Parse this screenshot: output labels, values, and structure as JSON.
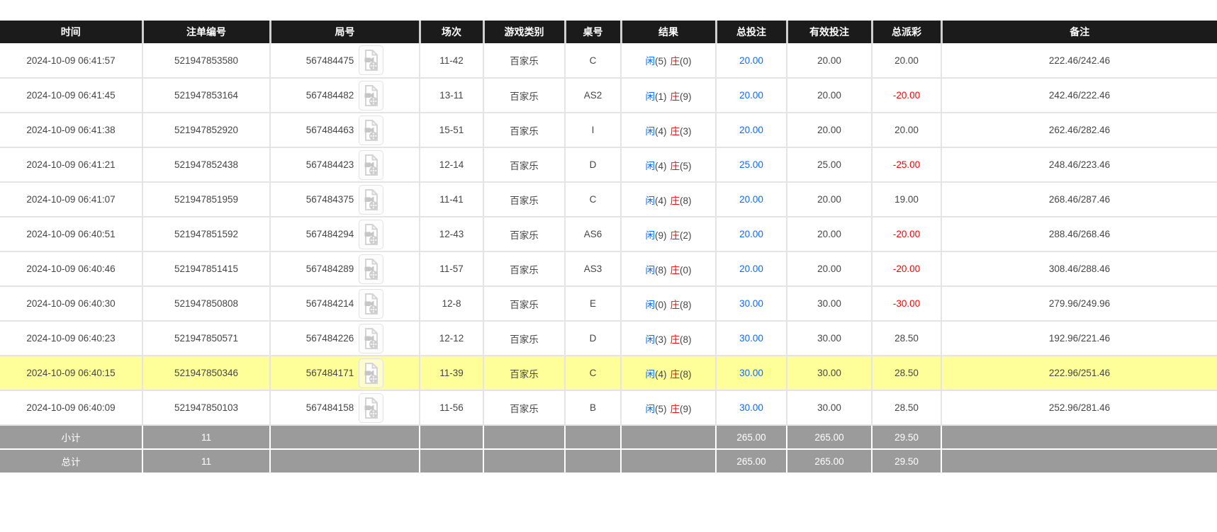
{
  "columns": [
    {
      "label": "时间"
    },
    {
      "label": "注单编号"
    },
    {
      "label": "局号"
    },
    {
      "label": "场次"
    },
    {
      "label": "游戏类别"
    },
    {
      "label": "桌号"
    },
    {
      "label": "结果"
    },
    {
      "label": "总投注"
    },
    {
      "label": "有效投注"
    },
    {
      "label": "总派彩"
    },
    {
      "label": "备注"
    }
  ],
  "labels": {
    "xian": "闲",
    "zhuang": "庄",
    "video_icon": "video-replay-icon"
  },
  "colors": {
    "header_bg": "#1b1b1b",
    "highlight_row": "#ffff99",
    "footer_bg": "#9b9b9b",
    "bet_blue": "#0b6aff",
    "loss_red": "#ff0000"
  },
  "rows": [
    {
      "time": "2024-10-09 06:41:57",
      "bet_no": "521947853580",
      "round_no": "567484475",
      "session": "11-42",
      "game_type": "百家乐",
      "table_no": "C",
      "result": {
        "xian": "(5)",
        "zhuang": "(0)"
      },
      "total_bet": "20.00",
      "valid_bet": "20.00",
      "payout": "20.00",
      "remark": "222.46/242.46",
      "highlighted": false
    },
    {
      "time": "2024-10-09 06:41:45",
      "bet_no": "521947853164",
      "round_no": "567484482",
      "session": "13-11",
      "game_type": "百家乐",
      "table_no": "AS2",
      "result": {
        "xian": "(1)",
        "zhuang": "(9)"
      },
      "total_bet": "20.00",
      "valid_bet": "20.00",
      "payout": "-20.00",
      "remark": "242.46/222.46",
      "highlighted": false
    },
    {
      "time": "2024-10-09 06:41:38",
      "bet_no": "521947852920",
      "round_no": "567484463",
      "session": "15-51",
      "game_type": "百家乐",
      "table_no": "I",
      "result": {
        "xian": "(4)",
        "zhuang": "(3)"
      },
      "total_bet": "20.00",
      "valid_bet": "20.00",
      "payout": "20.00",
      "remark": "262.46/282.46",
      "highlighted": false
    },
    {
      "time": "2024-10-09 06:41:21",
      "bet_no": "521947852438",
      "round_no": "567484423",
      "session": "12-14",
      "game_type": "百家乐",
      "table_no": "D",
      "result": {
        "xian": "(4)",
        "zhuang": "(5)"
      },
      "total_bet": "25.00",
      "valid_bet": "25.00",
      "payout": "-25.00",
      "remark": "248.46/223.46",
      "highlighted": false
    },
    {
      "time": "2024-10-09 06:41:07",
      "bet_no": "521947851959",
      "round_no": "567484375",
      "session": "11-41",
      "game_type": "百家乐",
      "table_no": "C",
      "result": {
        "xian": "(4)",
        "zhuang": "(8)"
      },
      "total_bet": "20.00",
      "valid_bet": "20.00",
      "payout": "19.00",
      "remark": "268.46/287.46",
      "highlighted": false
    },
    {
      "time": "2024-10-09 06:40:51",
      "bet_no": "521947851592",
      "round_no": "567484294",
      "session": "12-43",
      "game_type": "百家乐",
      "table_no": "AS6",
      "result": {
        "xian": "(9)",
        "zhuang": "(2)"
      },
      "total_bet": "20.00",
      "valid_bet": "20.00",
      "payout": "-20.00",
      "remark": "288.46/268.46",
      "highlighted": false
    },
    {
      "time": "2024-10-09 06:40:46",
      "bet_no": "521947851415",
      "round_no": "567484289",
      "session": "11-57",
      "game_type": "百家乐",
      "table_no": "AS3",
      "result": {
        "xian": "(8)",
        "zhuang": "(0)"
      },
      "total_bet": "20.00",
      "valid_bet": "20.00",
      "payout": "-20.00",
      "remark": "308.46/288.46",
      "highlighted": false
    },
    {
      "time": "2024-10-09 06:40:30",
      "bet_no": "521947850808",
      "round_no": "567484214",
      "session": "12-8",
      "game_type": "百家乐",
      "table_no": "E",
      "result": {
        "xian": "(0)",
        "zhuang": "(8)"
      },
      "total_bet": "30.00",
      "valid_bet": "30.00",
      "payout": "-30.00",
      "remark": "279.96/249.96",
      "highlighted": false
    },
    {
      "time": "2024-10-09 06:40:23",
      "bet_no": "521947850571",
      "round_no": "567484226",
      "session": "12-12",
      "game_type": "百家乐",
      "table_no": "D",
      "result": {
        "xian": "(3)",
        "zhuang": "(8)"
      },
      "total_bet": "30.00",
      "valid_bet": "30.00",
      "payout": "28.50",
      "remark": "192.96/221.46",
      "highlighted": false
    },
    {
      "time": "2024-10-09 06:40:15",
      "bet_no": "521947850346",
      "round_no": "567484171",
      "session": "11-39",
      "game_type": "百家乐",
      "table_no": "C",
      "result": {
        "xian": "(4)",
        "zhuang": "(8)"
      },
      "total_bet": "30.00",
      "valid_bet": "30.00",
      "payout": "28.50",
      "remark": "222.96/251.46",
      "highlighted": true
    },
    {
      "time": "2024-10-09 06:40:09",
      "bet_no": "521947850103",
      "round_no": "567484158",
      "session": "11-56",
      "game_type": "百家乐",
      "table_no": "B",
      "result": {
        "xian": "(5)",
        "zhuang": "(9)"
      },
      "total_bet": "30.00",
      "valid_bet": "30.00",
      "payout": "28.50",
      "remark": "252.96/281.46",
      "highlighted": false
    }
  ],
  "footer": {
    "subtotal": {
      "label": "小计",
      "count": "11",
      "total_bet": "265.00",
      "valid_bet": "265.00",
      "payout": "29.50"
    },
    "total": {
      "label": "总计",
      "count": "11",
      "total_bet": "265.00",
      "valid_bet": "265.00",
      "payout": "29.50"
    }
  }
}
